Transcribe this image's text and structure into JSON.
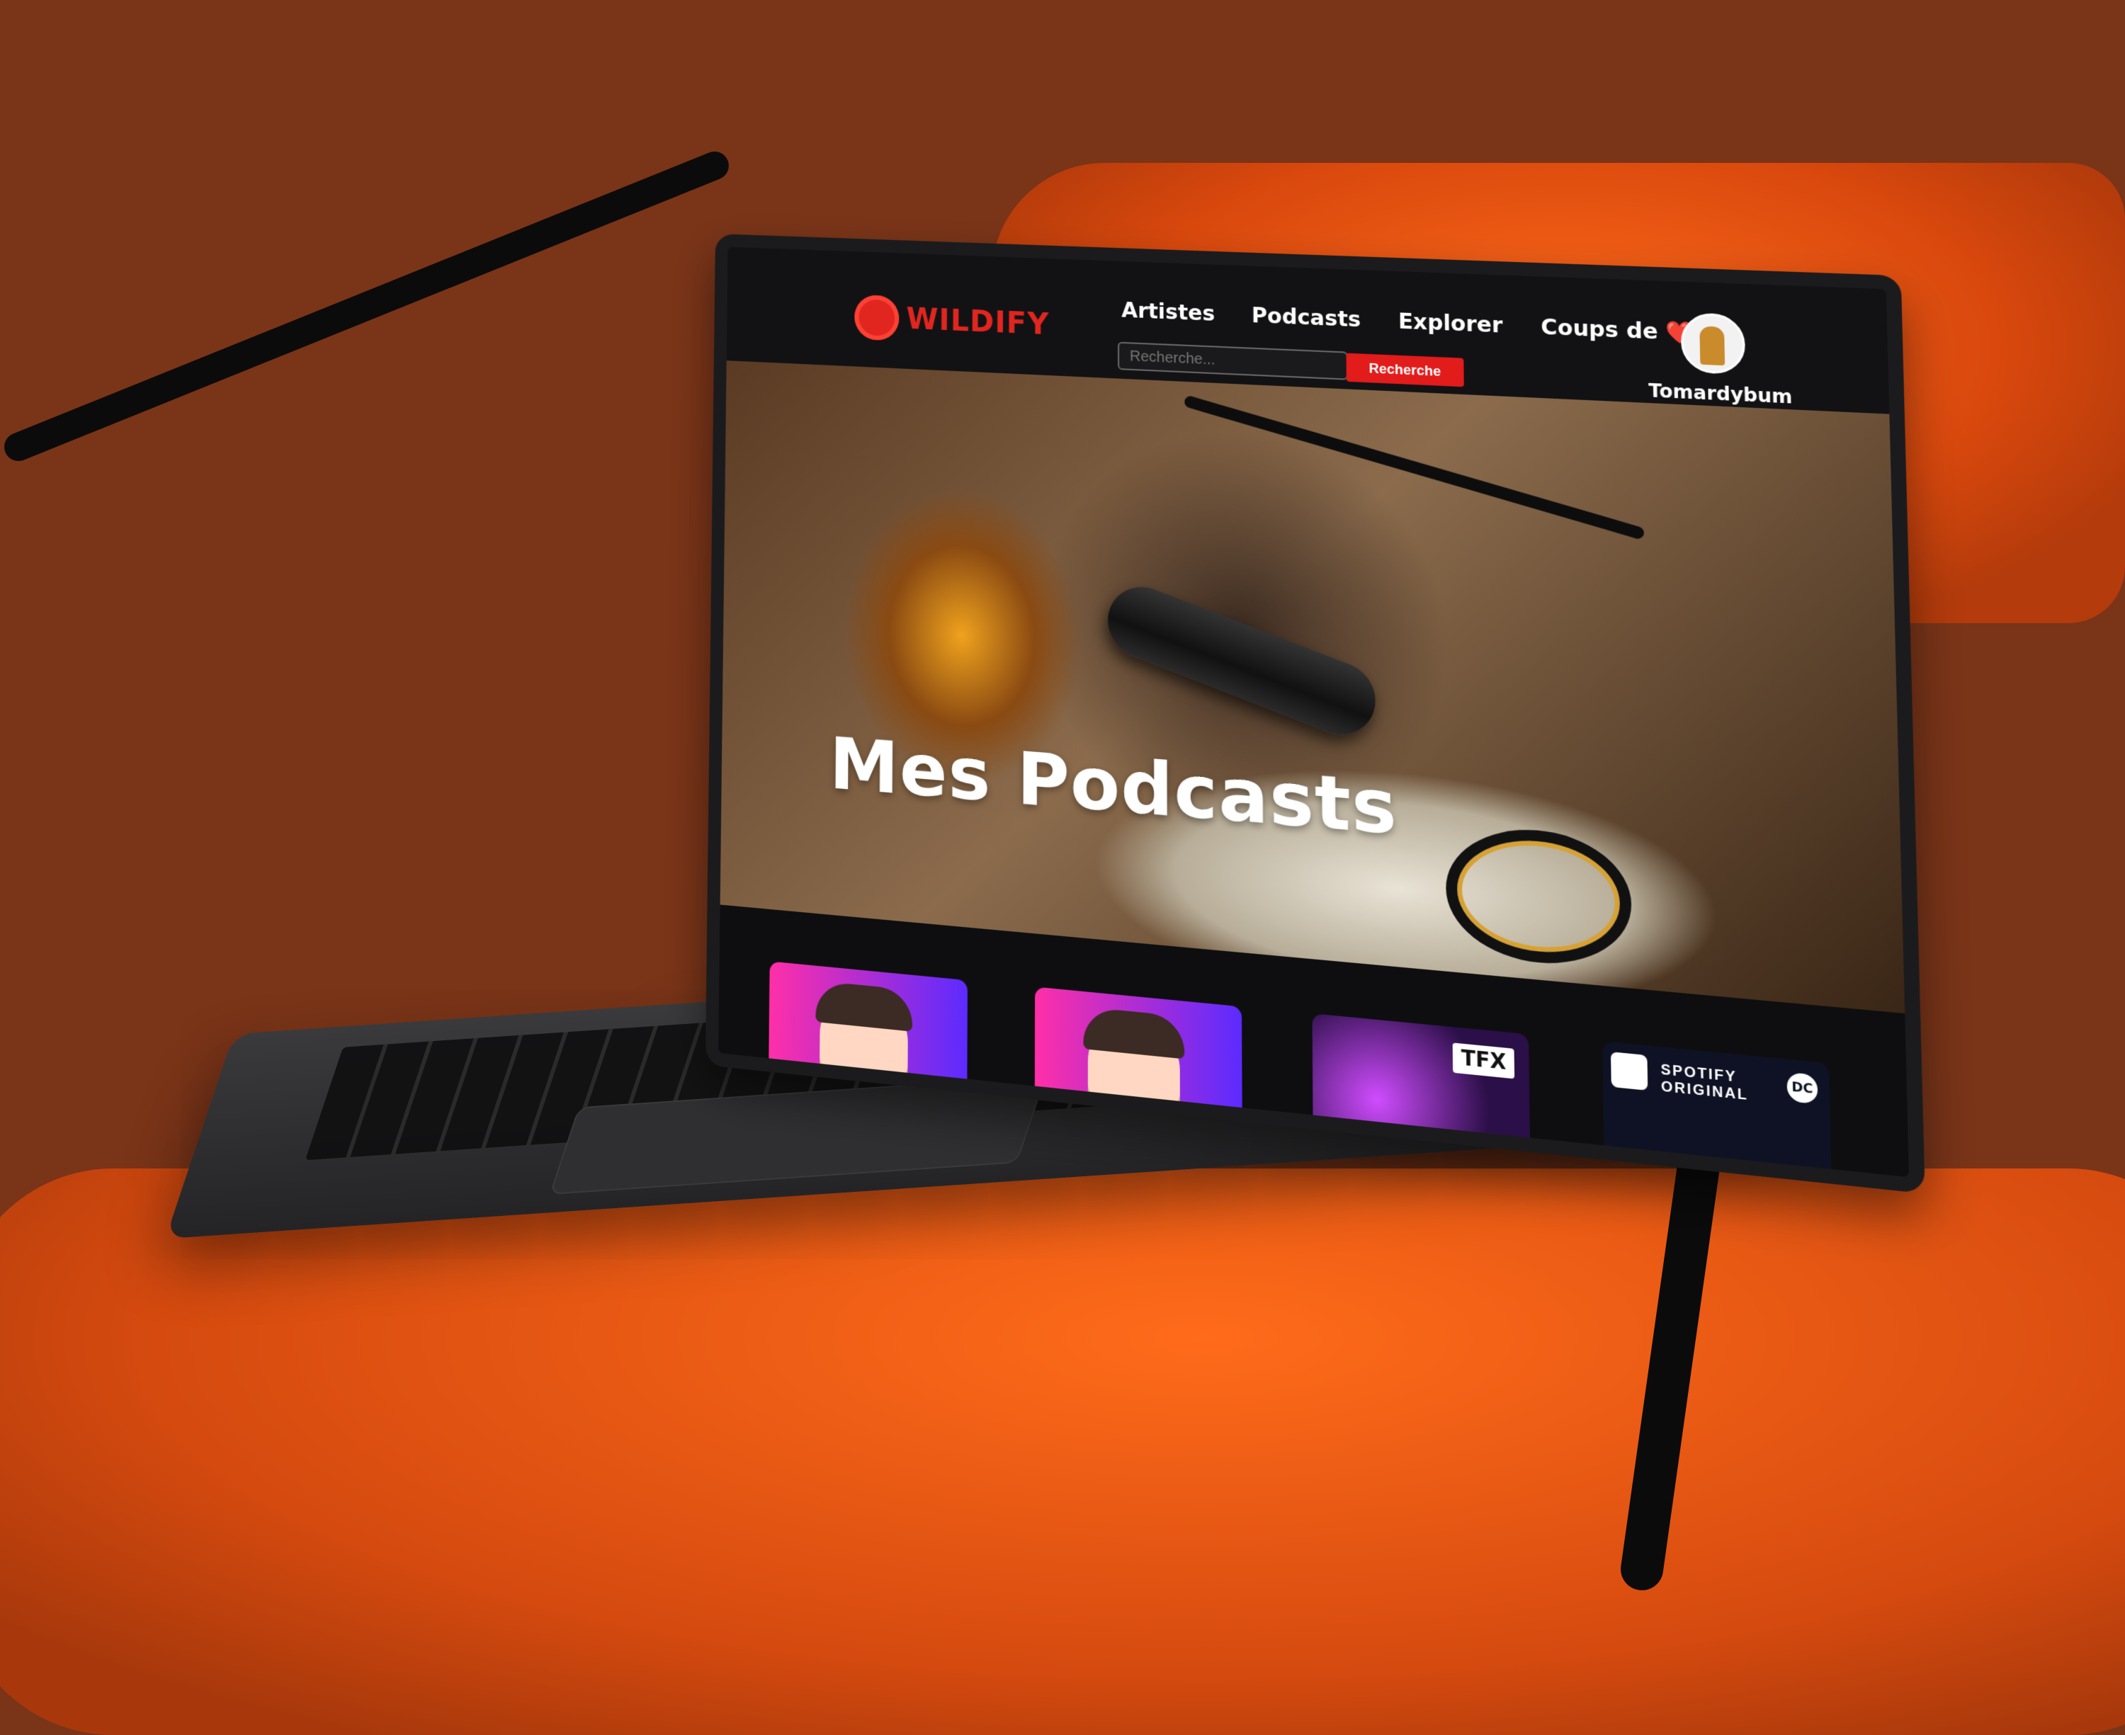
{
  "brand": {
    "name": "WILDIFY"
  },
  "nav": [
    "Artistes",
    "Podcasts",
    "Explorer",
    "Coups de ❤️"
  ],
  "search": {
    "placeholder": "Recherche...",
    "button_label": "Recherche"
  },
  "user": {
    "name": "Tomardybum"
  },
  "hero": {
    "title": "Mes Podcasts"
  },
  "cards": [
    {
      "type": "portrait",
      "badge": ""
    },
    {
      "type": "portrait",
      "badge": ""
    },
    {
      "type": "tfx",
      "badge": "TFX"
    },
    {
      "type": "spotify",
      "label": "SPOTIFY ORIGINAL",
      "badge": "DC"
    }
  ],
  "colors": {
    "accent": "#e21b1b",
    "background": "#0e0e10",
    "chair": "#d9480d"
  }
}
